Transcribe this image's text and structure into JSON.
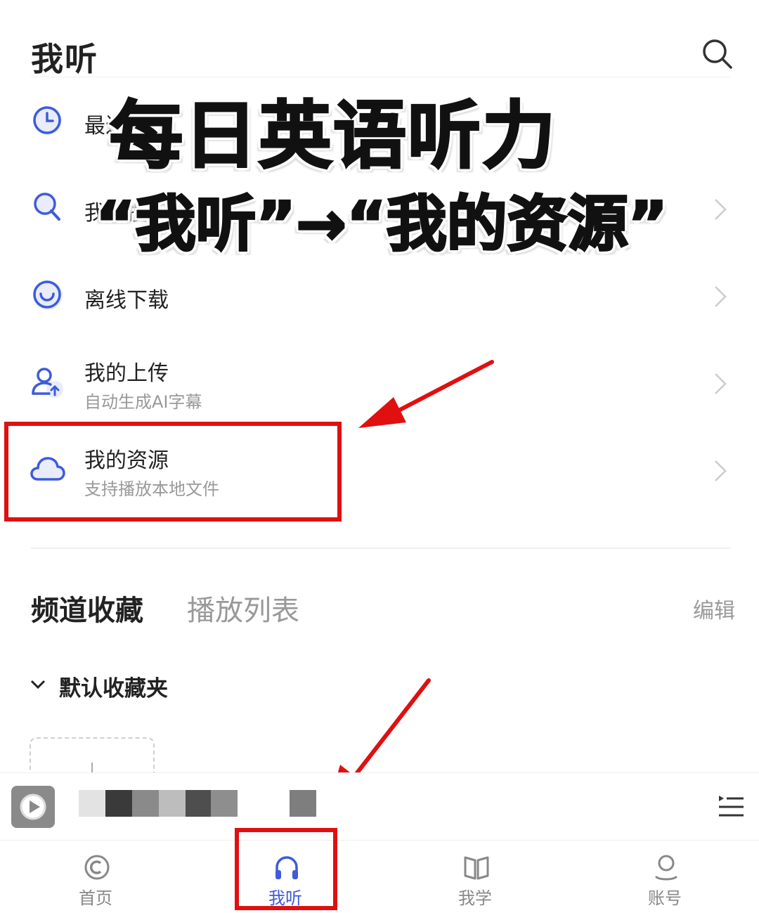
{
  "header": {
    "title": "我听"
  },
  "menu": [
    {
      "label": "最近播放",
      "subtitle": ""
    },
    {
      "label": "我的搜索",
      "subtitle": ""
    },
    {
      "label": "离线下载",
      "subtitle": ""
    },
    {
      "label": "我的上传",
      "subtitle": "自动生成AI字幕"
    },
    {
      "label": "我的资源",
      "subtitle": "支持播放本地文件"
    }
  ],
  "overlay": {
    "line1": "每日英语听力",
    "line2": "“我听”→“我的资源”"
  },
  "section_tabs": {
    "active": "频道收藏",
    "inactive": "播放列表",
    "edit": "编辑"
  },
  "folder": {
    "label": "默认收藏夹"
  },
  "bottom_nav": [
    {
      "label": "首页",
      "icon": "home-icon"
    },
    {
      "label": "我听",
      "icon": "headphones-icon"
    },
    {
      "label": "我学",
      "icon": "book-icon"
    },
    {
      "label": "账号",
      "icon": "account-icon"
    }
  ],
  "colors": {
    "accent": "#3e5bd8",
    "annotation_red": "#e01010"
  }
}
